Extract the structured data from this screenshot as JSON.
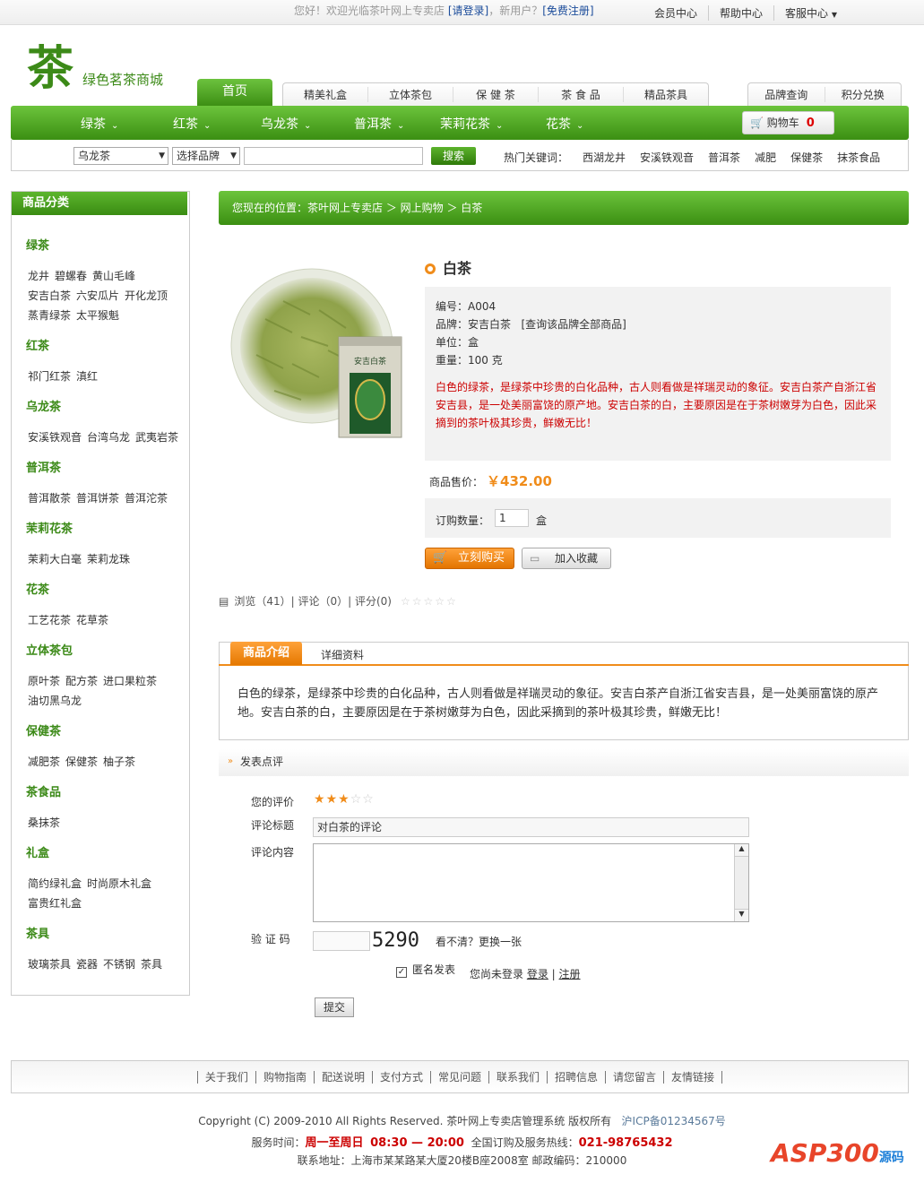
{
  "topbar": {
    "welcome": "您好！欢迎光临茶叶网上专卖店",
    "login": "[请登录]",
    "new_user": "，新用户？",
    "register": "[免费注册]",
    "links": [
      "会员中心",
      "帮助中心",
      "客服中心"
    ]
  },
  "logo": {
    "text": "绿色茗茶商城",
    "glyph": "茶"
  },
  "nav": {
    "home": "首页",
    "tabs": [
      "精美礼盒",
      "立体茶包",
      "保 健 茶",
      "茶 食 品",
      "精品茶具"
    ],
    "right_tabs": [
      "品牌查询",
      "积分兑换"
    ],
    "green": [
      "绿茶",
      "红茶",
      "乌龙茶",
      "普洱茶",
      "茉莉花茶",
      "花茶"
    ],
    "cart_label": "购物车",
    "cart_count": "0"
  },
  "search": {
    "category": "乌龙茶",
    "brand": "选择品牌",
    "button": "搜索",
    "hot_label": "热门关键词：",
    "hot": [
      "西湖龙井",
      "安溪铁观音",
      "普洱茶",
      "减肥",
      "保健茶",
      "抹茶食品"
    ]
  },
  "sidebar": {
    "title": "商品分类",
    "cats": [
      {
        "name": "绿茶",
        "items": [
          "龙井",
          "碧螺春",
          "黄山毛峰",
          "安吉白茶",
          "六安瓜片",
          "开化龙顶",
          "蒸青绿茶",
          "太平猴魁"
        ]
      },
      {
        "name": "红茶",
        "items": [
          "祁门红茶",
          "滇红"
        ]
      },
      {
        "name": "乌龙茶",
        "items": [
          "安溪铁观音",
          "台湾乌龙",
          "武夷岩茶"
        ]
      },
      {
        "name": "普洱茶",
        "items": [
          "普洱散茶",
          "普洱饼茶",
          "普洱沱茶"
        ]
      },
      {
        "name": "茉莉花茶",
        "items": [
          "茉莉大白毫",
          "茉莉龙珠"
        ]
      },
      {
        "name": "花茶",
        "items": [
          "工艺花茶",
          "花草茶"
        ]
      },
      {
        "name": "立体茶包",
        "items": [
          "原叶茶",
          "配方茶",
          "进口果粒茶",
          "油切黑乌龙"
        ]
      },
      {
        "name": "保健茶",
        "items": [
          "减肥茶",
          "保健茶",
          "柚子茶"
        ]
      },
      {
        "name": "茶食品",
        "items": [
          "桑抹茶"
        ]
      },
      {
        "name": "礼盒",
        "items": [
          "简约绿礼盒",
          "时尚原木礼盒",
          "富贵红礼盒"
        ]
      },
      {
        "name": "茶具",
        "items": [
          "玻璃茶具",
          "瓷器",
          "不锈钢",
          "茶具"
        ]
      }
    ]
  },
  "breadcrumb": "您现在的位置：茶叶网上专卖店 ＞ 网上购物 ＞ 白茶",
  "product": {
    "title": "白茶",
    "code": "编号：A004",
    "brand": "品牌：安吉白茶",
    "brand_link": "[查询该品牌全部商品]",
    "unit": "单位：盒",
    "weight": "重量：100 克",
    "desc": "白色的绿茶，是绿茶中珍贵的白化品种，古人则看做是祥瑞灵动的象征。安吉白茶产自浙江省安吉县，是一处美丽富饶的原产地。安吉白茶的白，主要原因是在于茶树嫩芽为白色，因此采摘到的茶叶极其珍贵，鲜嫩无比！",
    "price_label": "商品售价：",
    "price": "￥432.00",
    "qty_label": "订购数量：",
    "qty": "1",
    "qty_unit": "盒",
    "buy": "立刻购买",
    "fav": "加入收藏",
    "can_label": "安吉白茶",
    "stats": "浏览（41）| 评论（0）| 评分(0)",
    "stars": "☆☆☆☆☆"
  },
  "intro": {
    "tab1": "商品介绍",
    "tab2": "详细资料",
    "text": "白色的绿茶，是绿茶中珍贵的白化品种，古人则看做是祥瑞灵动的象征。安吉白茶产自浙江省安吉县，是一处美丽富饶的原产地。安吉白茶的白，主要原因是在于茶树嫩芽为白色，因此采摘到的茶叶极其珍贵，鲜嫩无比！"
  },
  "comment": {
    "head": "发表点评",
    "rating_label": "您的评价",
    "rating": 3,
    "rating_max": 5,
    "title_label": "评论标题",
    "title_value": "对白茶的评论",
    "content_label": "评论内容",
    "captcha_label": "验 证 码",
    "captcha": "5290",
    "refresh": "看不清？更换一张",
    "anon": "匿名发表",
    "not_logged": "您尚未登录",
    "login": "登录",
    "register": "注册",
    "submit": "提交"
  },
  "footer": {
    "links": [
      "关于我们",
      "购物指南",
      "配送说明",
      "支付方式",
      "常见问题",
      "联系我们",
      "招聘信息",
      "请您留言",
      "友情链接"
    ],
    "copyright": "Copyright (C) 2009-2010 All Rights Reserved. 茶叶网上专卖店管理系统 版权所有",
    "icp": "沪ICP备01234567号",
    "service_label": "服务时间：",
    "service_days": "周一至周日",
    "service_time": "08:30 — 20:00",
    "hotline_label": "全国订购及服务热线：",
    "hotline": "021-98765432",
    "address": "联系地址：上海市某某路某大厦20楼B座2008室   邮政编码：210000"
  },
  "watermark": {
    "main": "ASP300",
    "sub": "源码"
  },
  "colors": {
    "green": "#3b8f12",
    "orange": "#f08c1a",
    "red": "#cc0000"
  }
}
